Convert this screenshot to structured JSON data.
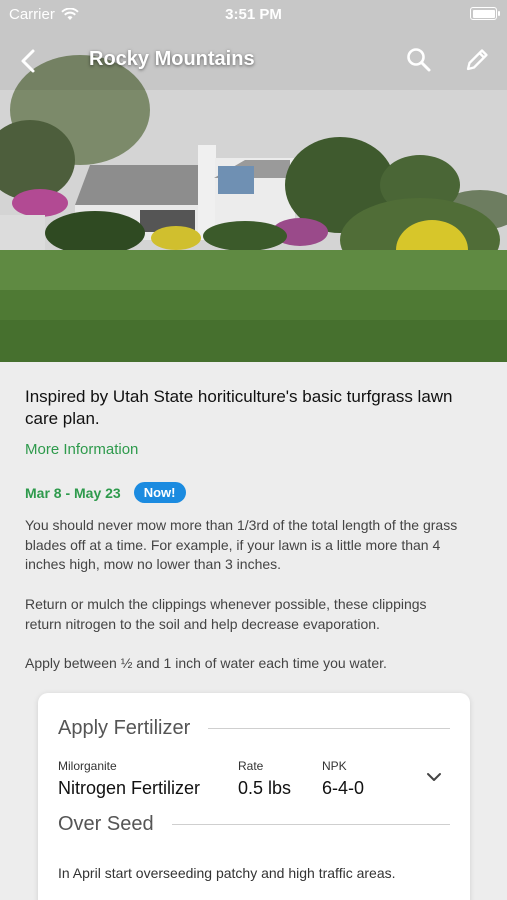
{
  "status_bar": {
    "carrier": "Carrier",
    "time": "3:51 PM"
  },
  "nav": {
    "title": "Rocky Mountains"
  },
  "intro": "Inspired by Utah State horiticulture's basic turfgrass lawn care plan.",
  "more_info_label": "More Information",
  "period": {
    "date_range": "Mar 8 - May 23",
    "badge": "Now!"
  },
  "paragraphs": [
    "You should never mow more than 1/3rd of the total length of the grass blades off at a time. For example, if your lawn is a little more than 4 inches high, mow no lower than 3 inches.",
    "Return or mulch the clippings whenever possible, these clippings return nitrogen to the soil and help decrease evaporation.",
    "Apply between ½ and 1 inch of water each time you water."
  ],
  "card": {
    "fertilizer_title": "Apply Fertilizer",
    "product_label": "Milorganite",
    "product_value": "Nitrogen Fertilizer",
    "rate_label": "Rate",
    "rate_value": "0.5 lbs",
    "npk_label": "NPK",
    "npk_value": "6-4-0",
    "overseed_title": "Over Seed",
    "overseed_text": "In April start overseeding patchy and high traffic areas."
  },
  "colors": {
    "accent_green": "#2e9a4c",
    "badge_blue": "#1b8be0"
  },
  "icons": [
    "wifi-icon",
    "battery-icon",
    "back-chevron-icon",
    "search-icon",
    "edit-pencil-icon",
    "chevron-down-icon"
  ]
}
